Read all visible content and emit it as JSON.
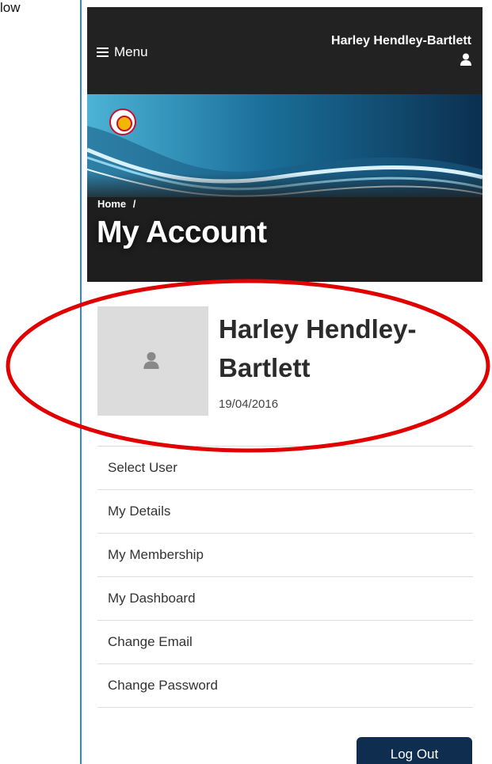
{
  "doc_fragment": "low",
  "topbar": {
    "menu_label": "Menu",
    "user_name": "Harley Hendley-Bartlett"
  },
  "banner": {
    "breadcrumb_home": "Home",
    "breadcrumb_separator": "/",
    "page_title": "My Account"
  },
  "profile": {
    "name_line1": "Harley Hendley-",
    "name_line2": "Bartlett",
    "date": "19/04/2016"
  },
  "account_menu": {
    "items": [
      {
        "label": "Select User"
      },
      {
        "label": "My Details"
      },
      {
        "label": "My Membership"
      },
      {
        "label": "My Dashboard"
      },
      {
        "label": "Change Email"
      },
      {
        "label": "Change Password"
      }
    ]
  },
  "logout_label": "Log Out",
  "colors": {
    "topbar_bg": "#222222",
    "logout_bg": "#0f2e4f",
    "annotation_ellipse": "#e00000",
    "frame_line": "#2e86de"
  },
  "icons": {
    "menu": "hamburger-icon",
    "user": "user-icon",
    "avatar_placeholder": "user-icon"
  }
}
